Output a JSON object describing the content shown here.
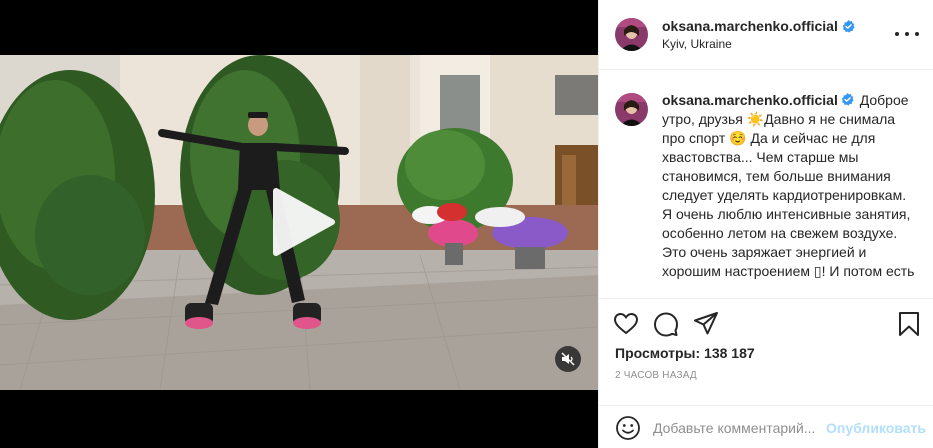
{
  "post": {
    "username": "oksana.marchenko.official",
    "location": "Kyiv, Ukraine",
    "verified": true,
    "caption": "Доброе утро, друзья ☀️Давно я не снимала про спорт ☺️ Да и сейчас не для хвастовства... Чем старше мы становимся, тем больше внимания следует уделять кардиотренировкам. Я очень люблю интенсивные занятия, особенно летом на свежем воздухе. Это очень заряжает энергией и хорошим настроением ▯! И потом есть",
    "views_label": "Просмотры: 138 187",
    "timestamp": "2 часов назад"
  },
  "comment": {
    "placeholder": "Добавьте комментарий...",
    "publish_label": "Опубликовать"
  },
  "icons": {
    "more": "more-options-icon",
    "like": "heart-icon",
    "comment": "comment-icon",
    "share": "share-icon",
    "save": "bookmark-icon",
    "emoji": "emoji-icon",
    "play": "play-icon",
    "mute": "muted-speaker-icon",
    "verified": "verified-badge-icon"
  },
  "colors": {
    "verified_blue": "#3897f0",
    "publish_disabled": "#b2dffc",
    "muted_text": "#8e8e8e"
  }
}
